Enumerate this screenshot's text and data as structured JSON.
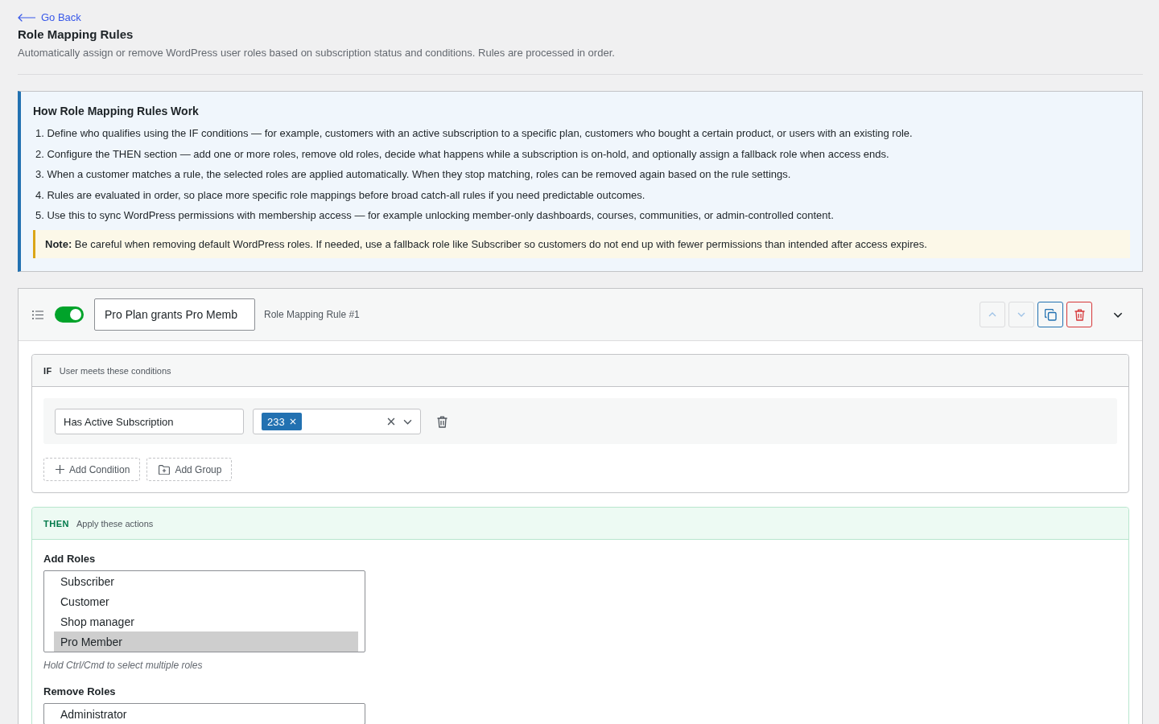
{
  "back_link": {
    "label": "Go Back"
  },
  "page": {
    "title": "Role Mapping Rules",
    "description": "Automatically assign or remove WordPress user roles based on subscription status and conditions. Rules are processed in order."
  },
  "info_box": {
    "title": "How Role Mapping Rules Work",
    "steps": [
      "1. Define who qualifies using the IF conditions — for example, customers with an active subscription to a specific plan, customers who bought a certain product, or users with an existing role.",
      "2. Configure the THEN section — add one or more roles, remove old roles, decide what happens while a subscription is on-hold, and optionally assign a fallback role when access ends.",
      "3. When a customer matches a rule, the selected roles are applied automatically. When they stop matching, roles can be removed again based on the rule settings.",
      "4. Rules are evaluated in order, so place more specific role mappings before broad catch-all rules if you need predictable outcomes.",
      "5. Use this to sync WordPress permissions with membership access — for example unlocking member-only dashboards, courses, communities, or admin-controlled content."
    ],
    "note": "**Note:** Be careful when removing default WordPress roles. If needed, use a fallback role like Subscriber so customers do not end up with fewer permissions than intended after access expires."
  },
  "rule": {
    "enabled": true,
    "name": "Pro Plan grants Pro Memb",
    "label": "Role Mapping Rule #1",
    "actions": [
      {
        "kind": "move-up",
        "disabled": true
      },
      {
        "kind": "move-down",
        "disabled": true
      },
      {
        "kind": "duplicate",
        "disabled": false
      },
      {
        "kind": "delete",
        "disabled": false
      }
    ],
    "if_section": {
      "keyword": "IF",
      "caption": "User meets these conditions",
      "conditions": [
        {
          "type": "Has Active Subscription",
          "values": [
            "233"
          ]
        }
      ],
      "buttons": [
        {
          "kind": "add-condition",
          "label": "Add Condition"
        },
        {
          "kind": "add-group",
          "label": "Add Group"
        }
      ]
    },
    "then_section": {
      "keyword": "THEN",
      "caption": "Apply these actions",
      "fields": [
        {
          "label": "Add Roles",
          "options": [
            {
              "label": "Subscriber",
              "selected": false
            },
            {
              "label": "Customer",
              "selected": false
            },
            {
              "label": "Shop manager",
              "selected": false
            },
            {
              "label": "Pro Member",
              "selected": true
            }
          ],
          "hint": "Hold Ctrl/Cmd to select multiple roles"
        },
        {
          "label": "Remove Roles",
          "options": [
            {
              "label": "Administrator",
              "selected": false
            }
          ]
        }
      ]
    }
  }
}
